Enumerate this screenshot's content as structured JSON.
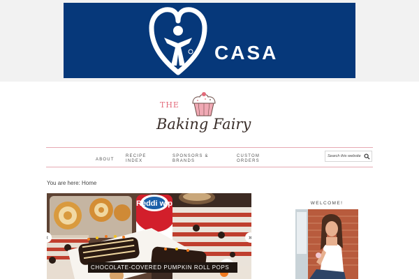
{
  "ad_banner": {
    "brand_text": "CASA",
    "background_color": "#06387a",
    "icon": "casa-heart-figure-logo"
  },
  "site_logo": {
    "the_text": "THE",
    "name_text": "Baking Fairy",
    "icon": "cupcake-icon",
    "accent_color": "#e36a7a"
  },
  "nav": {
    "items": [
      {
        "label": "About"
      },
      {
        "label": "Recipe Index"
      },
      {
        "label": "Sponsors & Brands"
      },
      {
        "label": "Custom Orders"
      }
    ],
    "search_placeholder": "Search this website",
    "search_icon": "search-icon",
    "rule_color": "#e6a9b2"
  },
  "breadcrumb": {
    "text": "You are here: Home"
  },
  "slider": {
    "caption": "CHOCOLATE-COVERED PUMPKIN ROLL POPS",
    "prev_label": "«",
    "next_label": "»",
    "product_label": "Reddi wip"
  },
  "sidebar": {
    "widget_title": "WELCOME!"
  }
}
